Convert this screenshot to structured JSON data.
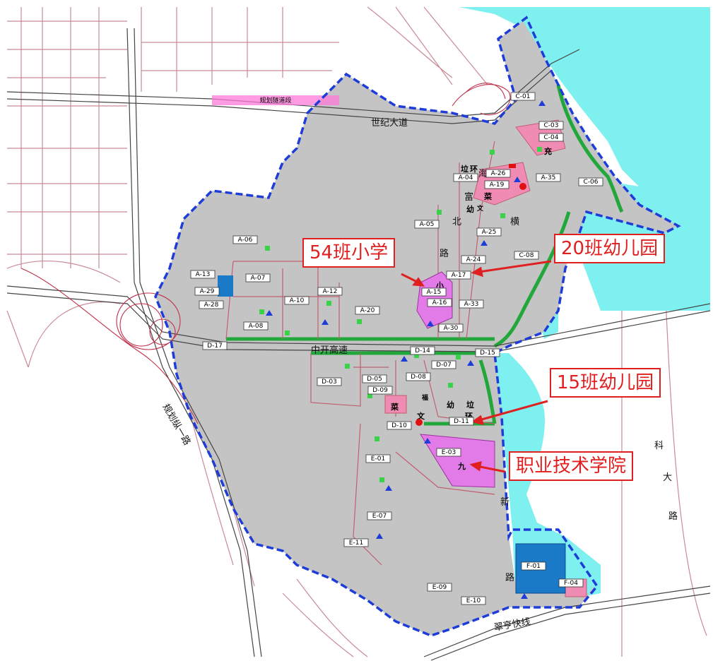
{
  "roads": {
    "shiji": "世纪大道",
    "zhongkai": "中开高速",
    "cuiheng": "翠亨快线",
    "guihua_zong": "规划纵一路",
    "tunnel": "规划隧道段",
    "beiheng": [
      "北",
      "横"
    ],
    "xinlu": [
      "新",
      "路"
    ],
    "keda": [
      "科",
      "大",
      "路"
    ],
    "hai": "海",
    "fu": "富",
    "lu": "路"
  },
  "parcels": [
    "A-06",
    "A-07",
    "A-13",
    "A-29",
    "A-28",
    "A-08",
    "A-10",
    "A-12",
    "A-20",
    "A-05",
    "A-04",
    "A-26",
    "A-19",
    "A-25",
    "A-24",
    "A-17",
    "A-15",
    "A-16",
    "A-33",
    "A-30",
    "A-35",
    "C-01",
    "C-03",
    "C-04",
    "C-06",
    "C-08",
    "D-17",
    "D-14",
    "D-15",
    "D-07",
    "D-08",
    "D-05",
    "D-09",
    "D-03",
    "D-10",
    "D-11",
    "E-01",
    "E-03",
    "E-07",
    "E-11",
    "E-09",
    "E-10",
    "F-01",
    "F-04"
  ],
  "facility_chars": {
    "la": "垃",
    "huan": "环",
    "cai": "菜",
    "you": "幼",
    "wen": "文",
    "xiao": "小",
    "chong": "充",
    "fu": "福",
    "jiu": "九"
  },
  "annotations": {
    "primary": "54班小学",
    "kinder20": "20班幼儿园",
    "kinder15": "15班幼儿园",
    "college": "职业技术学院"
  },
  "colors": {
    "planning_area": "#c4c4c4",
    "water": "#7ff0f0",
    "boundary": "#1e3cd8",
    "green": "#22a83a",
    "commercial": "#f08cb4",
    "education": "#e27ae8",
    "road": "#c06070",
    "callout": "#e02020"
  }
}
